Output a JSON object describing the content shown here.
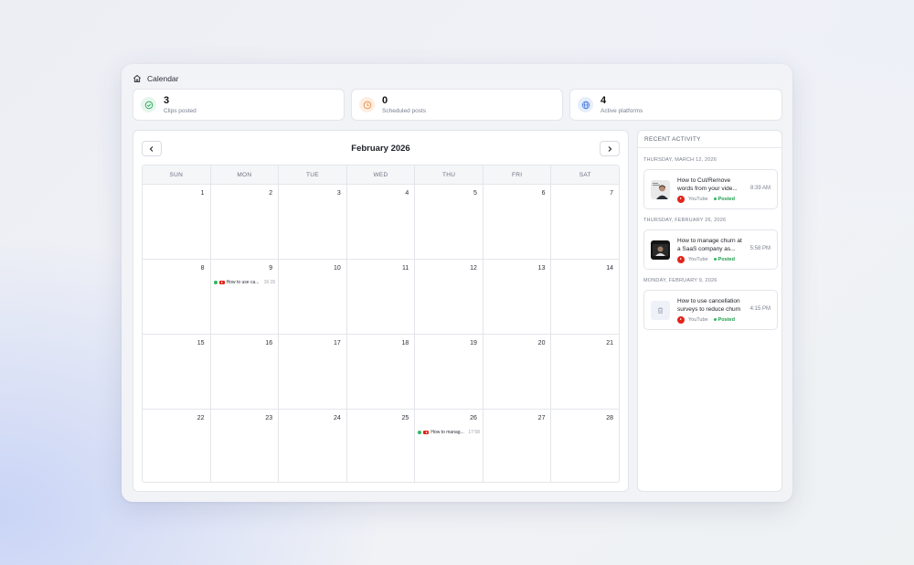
{
  "breadcrumb": {
    "icon": "home-icon",
    "label": "Calendar"
  },
  "stats": [
    {
      "value": "3",
      "label": "Clips posted",
      "icon": "check-circle-icon",
      "color": "#22a35a",
      "bg": "#e7f6ec"
    },
    {
      "value": "0",
      "label": "Scheduled posts",
      "icon": "clock-icon",
      "color": "#ef8a3c",
      "bg": "#fdeee2"
    },
    {
      "value": "4",
      "label": "Active platforms",
      "icon": "globe-icon",
      "color": "#4a7fe0",
      "bg": "#e6eefc"
    }
  ],
  "calendar": {
    "month_label": "February 2026",
    "prev_icon": "chevron-left-icon",
    "next_icon": "chevron-right-icon",
    "weekdays": [
      "SUN",
      "MON",
      "TUE",
      "WED",
      "THU",
      "FRI",
      "SAT"
    ],
    "weeks": [
      [
        "1",
        "2",
        "3",
        "4",
        "5",
        "6",
        "7"
      ],
      [
        "8",
        "9",
        "10",
        "11",
        "12",
        "13",
        "14"
      ],
      [
        "15",
        "16",
        "17",
        "18",
        "19",
        "20",
        "21"
      ],
      [
        "22",
        "23",
        "24",
        "25",
        "26",
        "27",
        "28"
      ]
    ],
    "events": [
      {
        "day": "9",
        "title": "How to use ca...",
        "time": "16:15",
        "platform": "youtube-icon",
        "status_color": "#2fb85f"
      },
      {
        "day": "26",
        "title": "How to manag...",
        "time": "17:58",
        "platform": "youtube-icon",
        "status_color": "#2fb85f"
      }
    ]
  },
  "activity": {
    "header": "RECENT ACTIVITY",
    "groups": [
      {
        "date": "THURSDAY, MARCH 12, 2026",
        "title": "How to Cut/Remove words from your vide...",
        "platform": "YouTube",
        "status": "Posted",
        "time": "8:39 AM",
        "thumb": "person-thumbnail"
      },
      {
        "date": "THURSDAY, FEBRUARY 26, 2026",
        "title": "How to manage churn at a SaaS company as...",
        "platform": "YouTube",
        "status": "Posted",
        "time": "5:58 PM",
        "thumb": "video-thumbnail"
      },
      {
        "date": "MONDAY, FEBRUARY 9, 2026",
        "title": "How to use cancellation surveys to reduce churn",
        "platform": "YouTube",
        "status": "Posted",
        "time": "4:15 PM",
        "thumb": "trash-icon"
      }
    ]
  }
}
